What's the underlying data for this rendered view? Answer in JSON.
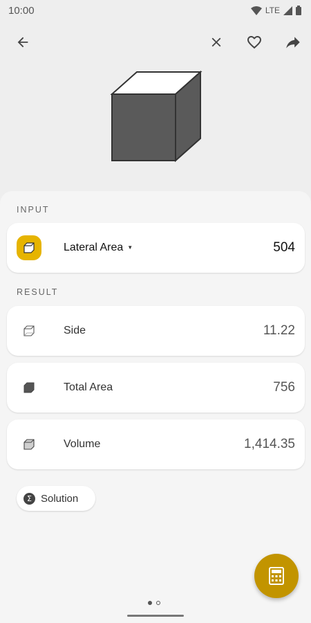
{
  "status_bar": {
    "time": "10:00",
    "network": "LTE",
    "icons": [
      "wifi-icon",
      "signal-icon",
      "battery-icon"
    ]
  },
  "toolbar": {
    "icons": [
      "back-arrow-icon",
      "close-icon",
      "heart-icon",
      "share-icon"
    ]
  },
  "hero": {
    "icon": "cube-icon"
  },
  "input": {
    "section_label": "INPUT",
    "field_label": "Lateral Area",
    "value": "504",
    "icon": "cube-face-icon",
    "accent_color": "#e6b400"
  },
  "result": {
    "section_label": "RESULT",
    "rows": [
      {
        "label": "Side",
        "value": "11.22",
        "icon": "cube-edge-icon"
      },
      {
        "label": "Total Area",
        "value": "756",
        "icon": "cube-solid-icon"
      },
      {
        "label": "Volume",
        "value": "1,414.35",
        "icon": "cube-grid-icon"
      }
    ]
  },
  "solution": {
    "label": "Solution",
    "icon": "sigma-icon"
  },
  "fab": {
    "icon": "calculator-icon",
    "color": "#c29400"
  },
  "pager": {
    "pages": 2,
    "active_page": 1
  }
}
